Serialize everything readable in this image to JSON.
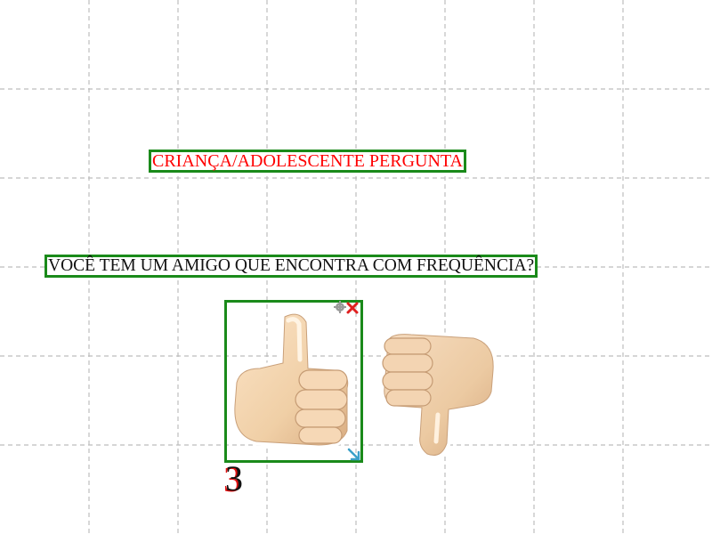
{
  "board": {
    "title": "CRIANÇA/ADOLESCENTE PERGUNTA",
    "question": "VOCÊ TEM UM AMIGO QUE ENCONTRA COM FREQUÊNCIA?",
    "title_color": "#ff0000",
    "frame_color": "#1a8a1a"
  },
  "stickers": {
    "yes": {
      "icon": "thumbs-up-icon"
    },
    "no": {
      "icon": "thumbs-down-icon"
    }
  },
  "selection": {
    "badge_number": "3",
    "delete_icon": "close-icon",
    "settings_icon": "gear-icon",
    "resize_icon": "resize-arrow-icon"
  }
}
